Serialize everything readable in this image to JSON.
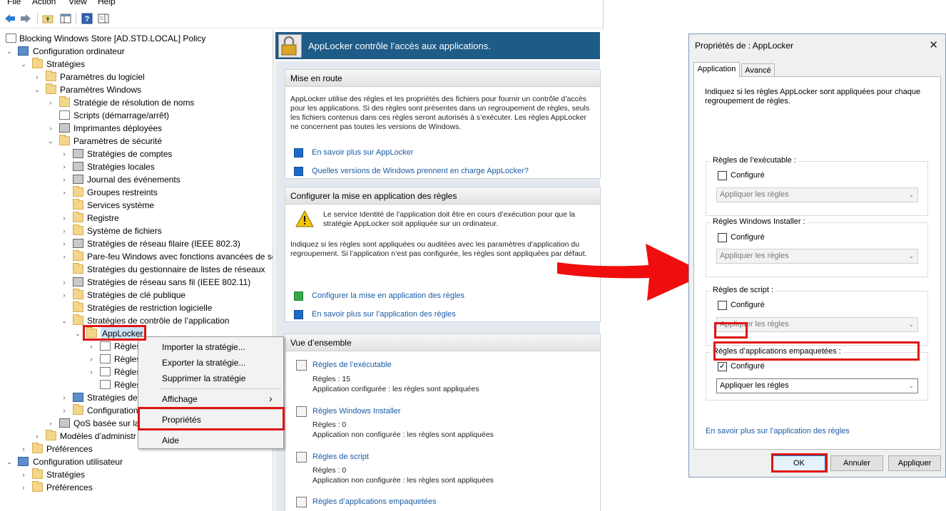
{
  "menu": {
    "file": "File",
    "action": "Action",
    "view": "View",
    "help": "Help"
  },
  "tree": {
    "items": [
      {
        "label": "Blocking Windows Store [AD.STD.LOCAL] Policy"
      },
      {
        "label": "Configuration ordinateur"
      },
      {
        "label": "Stratégies"
      },
      {
        "label": "Paramètres du logiciel"
      },
      {
        "label": "Paramètres Windows"
      },
      {
        "label": "Stratégie de résolution de noms"
      },
      {
        "label": "Scripts (démarrage/arrêt)"
      },
      {
        "label": "Imprimantes déployées"
      },
      {
        "label": "Paramètres de sécurité"
      },
      {
        "label": "Stratégies de comptes"
      },
      {
        "label": "Stratégies locales"
      },
      {
        "label": "Journal des événements"
      },
      {
        "label": "Groupes restreints"
      },
      {
        "label": "Services système"
      },
      {
        "label": "Registre"
      },
      {
        "label": "Système de fichiers"
      },
      {
        "label": "Stratégies de réseau filaire (IEEE 802.3)"
      },
      {
        "label": "Pare-feu Windows avec fonctions avancées de sé"
      },
      {
        "label": "Stratégies du gestionnaire de listes de réseaux"
      },
      {
        "label": "Stratégies de réseau sans fil (IEEE 802.11)"
      },
      {
        "label": "Stratégies de clé publique"
      },
      {
        "label": "Stratégies de restriction logicielle"
      },
      {
        "label": "Stratégies de contrôle de l’application"
      },
      {
        "label": "AppLocker"
      },
      {
        "label": "Règles"
      },
      {
        "label": "Règles"
      },
      {
        "label": "Règles"
      },
      {
        "label": "Règles"
      },
      {
        "label": "Stratégies de"
      },
      {
        "label": "Configuration"
      },
      {
        "label": "QoS basée sur la"
      },
      {
        "label": "Modèles d’administr"
      },
      {
        "label": "Préférences"
      },
      {
        "label": "Configuration utilisateur"
      },
      {
        "label": "Stratégies"
      },
      {
        "label": "Préférences"
      }
    ]
  },
  "context_menu": {
    "import": "Importer la stratégie...",
    "export": "Exporter la stratégie...",
    "delete": "Supprimer la stratégie",
    "view": "Affichage",
    "view_arrow": "›",
    "properties": "Propriétés",
    "help": "Aide"
  },
  "center": {
    "header": "AppLocker contrôle l’accès aux applications.",
    "getting_started": {
      "title": "Mise en route",
      "text": "AppLocker utilise des règles et les propriétés des fichiers pour fournir un contrôle d’accès pour les applications. Si des règles sont présentes dans un regroupement de règles, seuls les fichiers contenus dans ces règles seront autorisés à s’exécuter. Les règles AppLocker ne concernent pas toutes les versions de Windows.",
      "link1": "En savoir plus sur AppLocker",
      "link2": "Quelles versions de Windows prennent en charge AppLocker?"
    },
    "enforcement": {
      "title": "Configurer la mise en application des règles",
      "warning": "Le service Identité de l’application doit être en cours d’exécution pour que la stratégie AppLocker soit appliquée sur un ordinateur.",
      "text": "Indiquez si les règles sont appliquées ou auditées avec les paramètres d’application du regroupement. Si l’application n’est pas configurée, les règles sont appliquées par défaut.",
      "link1": "Configurer la mise en application des règles",
      "link2": "En savoir plus sur l’application des règles"
    },
    "overview": {
      "title": "Vue d’ensemble",
      "items": [
        {
          "link": "Règles de l’exécutable",
          "count": "Règles : 15",
          "status": "Application configurée : les règles sont appliquées"
        },
        {
          "link": "Règles Windows Installer",
          "count": "Règles : 0",
          "status": "Application non configurée : les règles sont appliquées"
        },
        {
          "link": "Règles de script",
          "count": "Règles : 0",
          "status": "Application non configurée : les règles sont appliquées"
        },
        {
          "link": "Règles d’applications empaquetées"
        }
      ]
    }
  },
  "dialog": {
    "title": "Propriétés de : AppLocker",
    "close": "✕",
    "tabs": {
      "application": "Application",
      "advanced": "Avancé"
    },
    "intro": "Indiquez si les règles AppLocker sont appliquées pour chaque regroupement de règles.",
    "groups": [
      {
        "title": "Règles de l’exécutable :",
        "checkbox": "Configuré",
        "checked": false,
        "select": "Appliquer les règles"
      },
      {
        "title": "Règles Windows Installer :",
        "checkbox": "Configuré",
        "checked": false,
        "select": "Appliquer les règles"
      },
      {
        "title": "Règles de script :",
        "checkbox": "Configuré",
        "checked": false,
        "select": "Appliquer les règles"
      },
      {
        "title": "Règles d’applications empaquetées :",
        "checkbox": "Configuré",
        "checked": true,
        "select": "Appliquer les règles"
      }
    ],
    "check_mark": "✓",
    "chevron": "⌄",
    "learn_more": "En savoir plus sur l’application des règles",
    "buttons": {
      "ok": "OK",
      "cancel": "Annuler",
      "apply": "Appliquer"
    }
  },
  "colors": {
    "highlight": "#e01414",
    "header_bg": "#1e5b87",
    "link": "#1a5ba6"
  }
}
